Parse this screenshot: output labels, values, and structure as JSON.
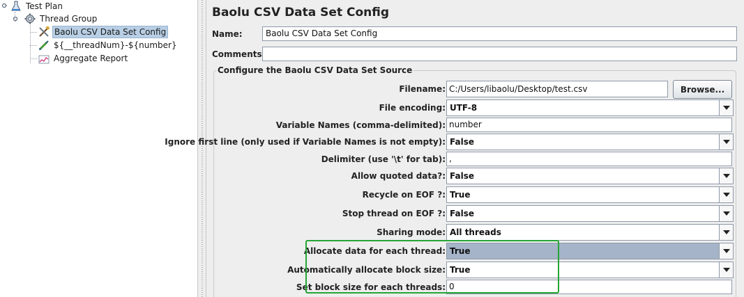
{
  "tree": {
    "items": [
      {
        "label": "Test Plan"
      },
      {
        "label": "Thread Group"
      },
      {
        "label": "Baolu CSV Data Set Config"
      },
      {
        "label": "${__threadNum}-${number}"
      },
      {
        "label": "Aggregate Report"
      }
    ]
  },
  "panel": {
    "title": "Baolu CSV Data Set Config",
    "name_label": "Name:",
    "name_value": "Baolu CSV Data Set Config",
    "comments_label": "Comments:",
    "comments_value": "",
    "group_title": "Configure the Baolu CSV Data Set Source",
    "browse_label": "Browse...",
    "fields": {
      "filename": {
        "label": "Filename:",
        "value": "C:/Users/libaolu/Desktop/test.csv"
      },
      "file_encoding": {
        "label": "File encoding:",
        "value": "UTF-8"
      },
      "variable_names": {
        "label": "Variable Names (comma-delimited):",
        "value": "number"
      },
      "ignore_first_line": {
        "label": "Ignore first line (only used if Variable Names is not empty):",
        "value": "False"
      },
      "delimiter": {
        "label": "Delimiter (use '\\t' for tab):",
        "value": ","
      },
      "allow_quoted": {
        "label": "Allow quoted data?:",
        "value": "False"
      },
      "recycle_eof": {
        "label": "Recycle on EOF ?:",
        "value": "True"
      },
      "stop_thread_eof": {
        "label": "Stop thread on EOF ?:",
        "value": "False"
      },
      "sharing_mode": {
        "label": "Sharing mode:",
        "value": "All threads"
      },
      "allocate_data": {
        "label": "Allocate data for each thread:",
        "value": "True"
      },
      "auto_block_size": {
        "label": "Automatically allocate block size:",
        "value": "True"
      },
      "block_size": {
        "label": "Set block size for each threads:",
        "value": "0"
      }
    }
  },
  "colors": {
    "highlight_box": "#25a535",
    "selected_tree_bg": "#b8cfe5",
    "selected_combo_bg": "#a5b4c8"
  }
}
